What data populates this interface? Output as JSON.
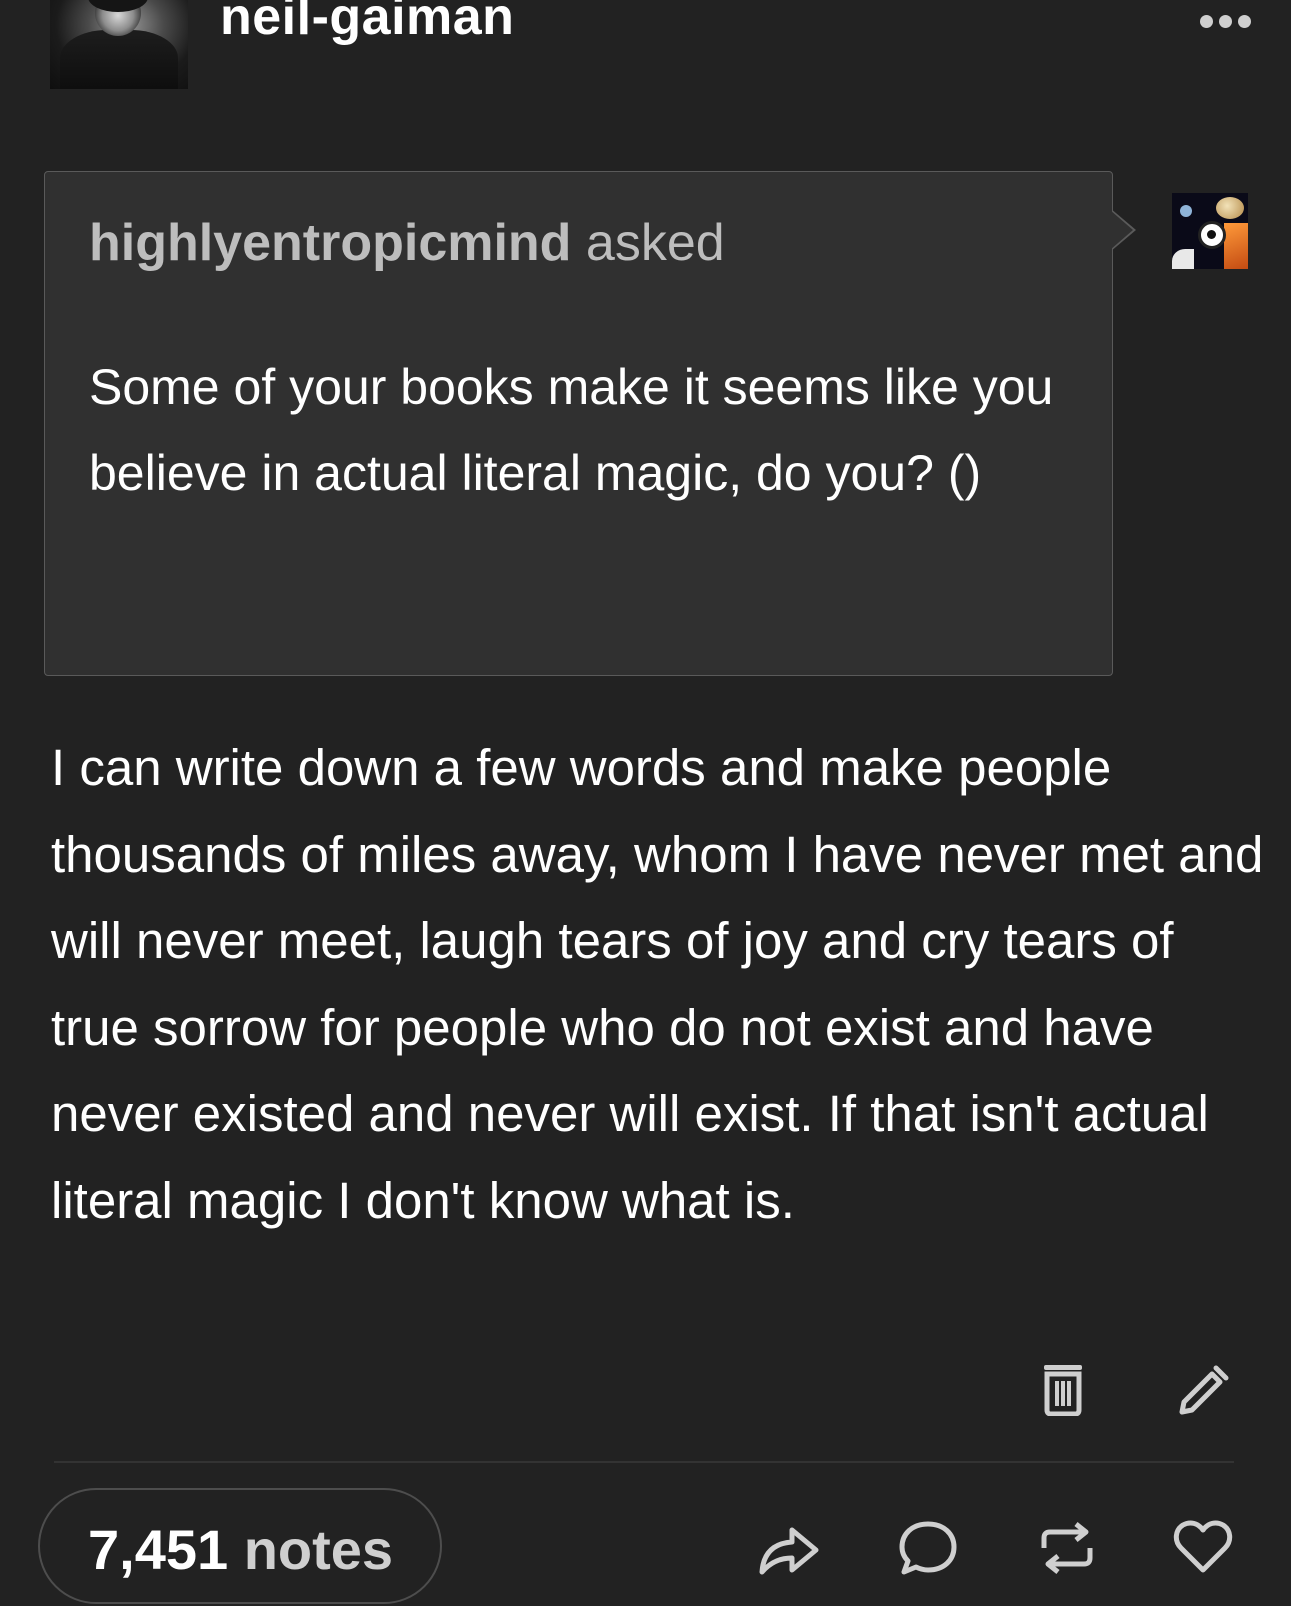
{
  "header": {
    "blog_name": "neil-gaiman"
  },
  "ask": {
    "asker": "highlyentropicmind",
    "verb": "asked",
    "question": "Some of your books make it seems like you believe in actual literal magic, do you? ()"
  },
  "answer": {
    "text": "I can write down a few words and make people thousands of miles away, whom I have never met and will never meet, laugh tears of joy and cry tears of true sorrow for people who do not exist and have never existed and never will exist. If that isn't actual literal magic I don't know what is."
  },
  "footer": {
    "notes_count": "7,451",
    "notes_label": "notes"
  },
  "icons": {
    "more": "more-horizontal-icon",
    "delete": "trash-icon",
    "edit": "pencil-icon",
    "share": "share-icon",
    "reply": "comment-icon",
    "reblog": "reblog-icon",
    "like": "heart-icon"
  },
  "colors": {
    "background": "#222222",
    "ask_box": "#303030",
    "text": "#ffffff",
    "muted_text": "#bdbdbd"
  }
}
